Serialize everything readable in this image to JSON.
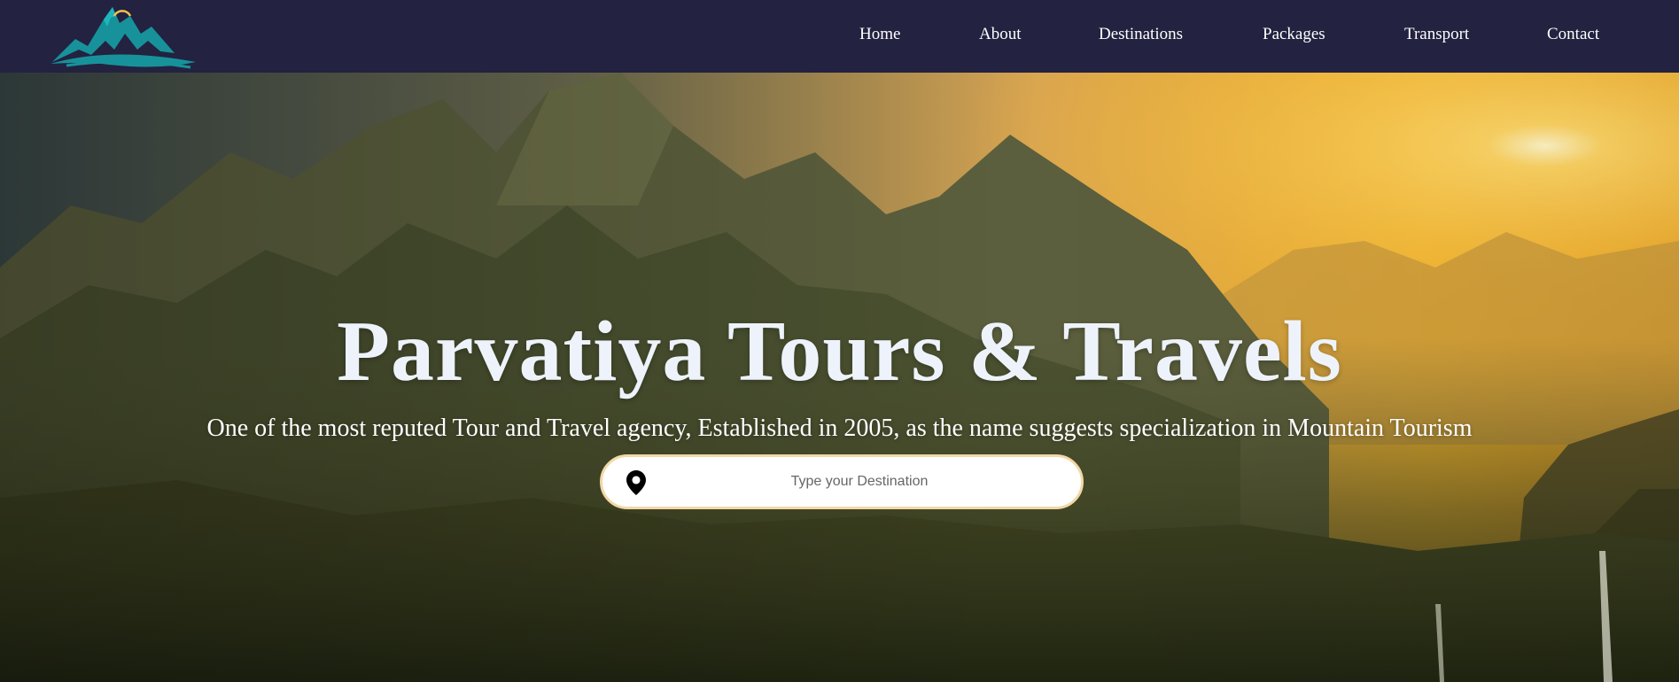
{
  "brand": {
    "logo_icon": "mountain-logo-icon",
    "colors": {
      "navbar": "#232240",
      "logo_teal": "#17929a",
      "search_border": "#f1d8a6"
    }
  },
  "nav": {
    "items": [
      {
        "label": "Home"
      },
      {
        "label": "About"
      },
      {
        "label": "Destinations"
      },
      {
        "label": "Packages"
      },
      {
        "label": "Transport"
      },
      {
        "label": "Contact"
      }
    ]
  },
  "hero": {
    "title": "Parvatiya Tours & Travels",
    "subtitle": "One of the most reputed Tour and Travel agency, Established in 2005, as the name suggests specialization in Mountain Tourism",
    "background": "mountain-sunset-landscape"
  },
  "search": {
    "icon": "location-pin-icon",
    "placeholder": "Type your Destination",
    "value": ""
  }
}
